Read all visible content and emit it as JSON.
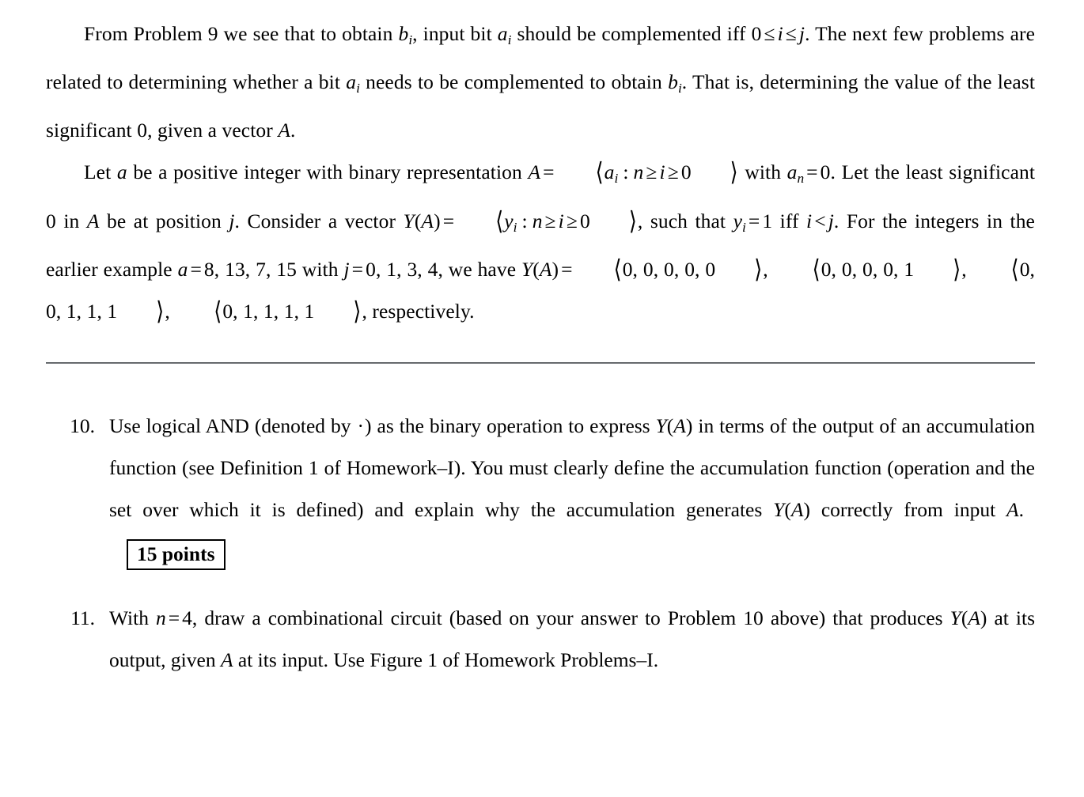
{
  "document": {
    "type": "homework-problem-sheet",
    "paragraphs": [
      {
        "id": "para-1",
        "indent": true,
        "text": "From Problem 9 we see that to obtain bᵢ, input bit aᵢ should be complemented iff 0 ≤ i ≤ j. The next few problems are related to determining whether a bit aᵢ needs to be complemented to obtain bᵢ. That is, determining the value of the least significant 0, given a vector A."
      },
      {
        "id": "para-2",
        "indent": true,
        "text": "Let a be a positive integer with binary representation A = ⟨aᵢ : n ≥ i ≥ 0⟩ with aₙ = 0. Let the least significant 0 in A be at position j. Consider a vector Y(A) = ⟨yᵢ : n ≥ i ≥ 0⟩, such that yᵢ = 1 iff i < j. For the integers in the earlier example a = 8, 13, 7, 15 with j = 0, 1, 3, 4, we have Y(A) = ⟨0, 0, 0, 0, 0⟩, ⟨0, 0, 0, 0, 1⟩, ⟨0, 0, 1, 1, 1⟩, ⟨0, 1, 1, 1, 1⟩, respectively."
      }
    ],
    "para1": {
      "f1": "From Problem 9 we see that to obtain ",
      "b": "b",
      "i_sub": "i",
      "f2": ", input bit ",
      "a": "a",
      "f3": " should be complemented iff ",
      "zero": "0",
      "le1": "≤",
      "ivar": "i",
      "le2": "≤",
      "jvar": "j",
      "f4": ". The next few problems are related to determining whether a bit ",
      "f5": " needs to be complemented to obtain ",
      "f6": ". That is, determining the value of the least significant 0, given a vector ",
      "Avar": "A",
      "f7": "."
    },
    "para2": {
      "s1": "Let ",
      "avar": "a",
      "s2": " be a positive integer with binary representation ",
      "Avar": "A",
      "eq": "=",
      "langle": "⟨",
      "rangle": "⟩",
      "asub": "a",
      "isub": "i",
      "colon": ":",
      "nvar": "n",
      "ge": "≥",
      "ivar": "i",
      "zero": "0",
      "s3": " with ",
      "nsub": "n",
      "s4": ". Let the least significant 0 in ",
      "s5": " be at position ",
      "jvar": "j",
      "s6": ". Consider a vector ",
      "Yvar": "Y",
      "lparen": "(",
      "rparen": ")",
      "ysub": "y",
      "s7": ", such that ",
      "one": "1",
      "s8": " iff ",
      "lt": "<",
      "s9": ". For the integers in the earlier example ",
      "alist": "8, 13, 7, 15",
      "s10": " with ",
      "jlist": "0, 1, 3, 4",
      "s11": ", we have ",
      "vec1": "0, 0, 0, 0, 0",
      "vec2": "0, 0, 0, 0, 1",
      "vec3": "0, 0, 1, 1, 1",
      "vec4": "0, 1, 1, 1, 1",
      "comma": ", ",
      "s12": ", respectively."
    },
    "rule": {
      "label": "horizontal-rule",
      "color": "#666a6e"
    },
    "problems": [
      {
        "number": "10.",
        "points_label": "15 points",
        "text": "Use logical AND (denoted by ·) as the binary operation to express Y(A) in terms of the output of an accumulation function (see Definition 1 of Homework–I). You must clearly define the accumulation function (operation and the set over which it is defined) and explain why the accumulation generates Y(A) correctly from input A.",
        "frag": {
          "t1": "Use logical AND (denoted by ",
          "dot": "·",
          "t2": ") as the binary operation to express ",
          "Y": "Y",
          "lp": "(",
          "A": "A",
          "rp": ")",
          "t3": " in terms of the output of an accumulation function (see Definition 1 of Homework–I). You must clearly define the accumulation function (operation and the set over which it is defined) and explain why the accumulation generates ",
          "t4": " correctly from input ",
          "t5": "."
        }
      },
      {
        "number": "11.",
        "points_label": "",
        "text": "With n = 4, draw a combinational circuit (based on your answer to Problem 10 above) that produces Y(A) at its output, given A at its input. Use Figure 1 of Homework Problems–I.",
        "frag": {
          "t1": "With ",
          "n": "n",
          "eq": "=",
          "four": "4",
          "t2": ", draw a combinational circuit (based on your answer to Problem 10 above) that produces ",
          "Y": "Y",
          "lp": "(",
          "A": "A",
          "rp": ")",
          "t3": " at its output, given ",
          "t4": " at its input. Use Figure 1 of Homework Problems–I."
        }
      }
    ]
  }
}
